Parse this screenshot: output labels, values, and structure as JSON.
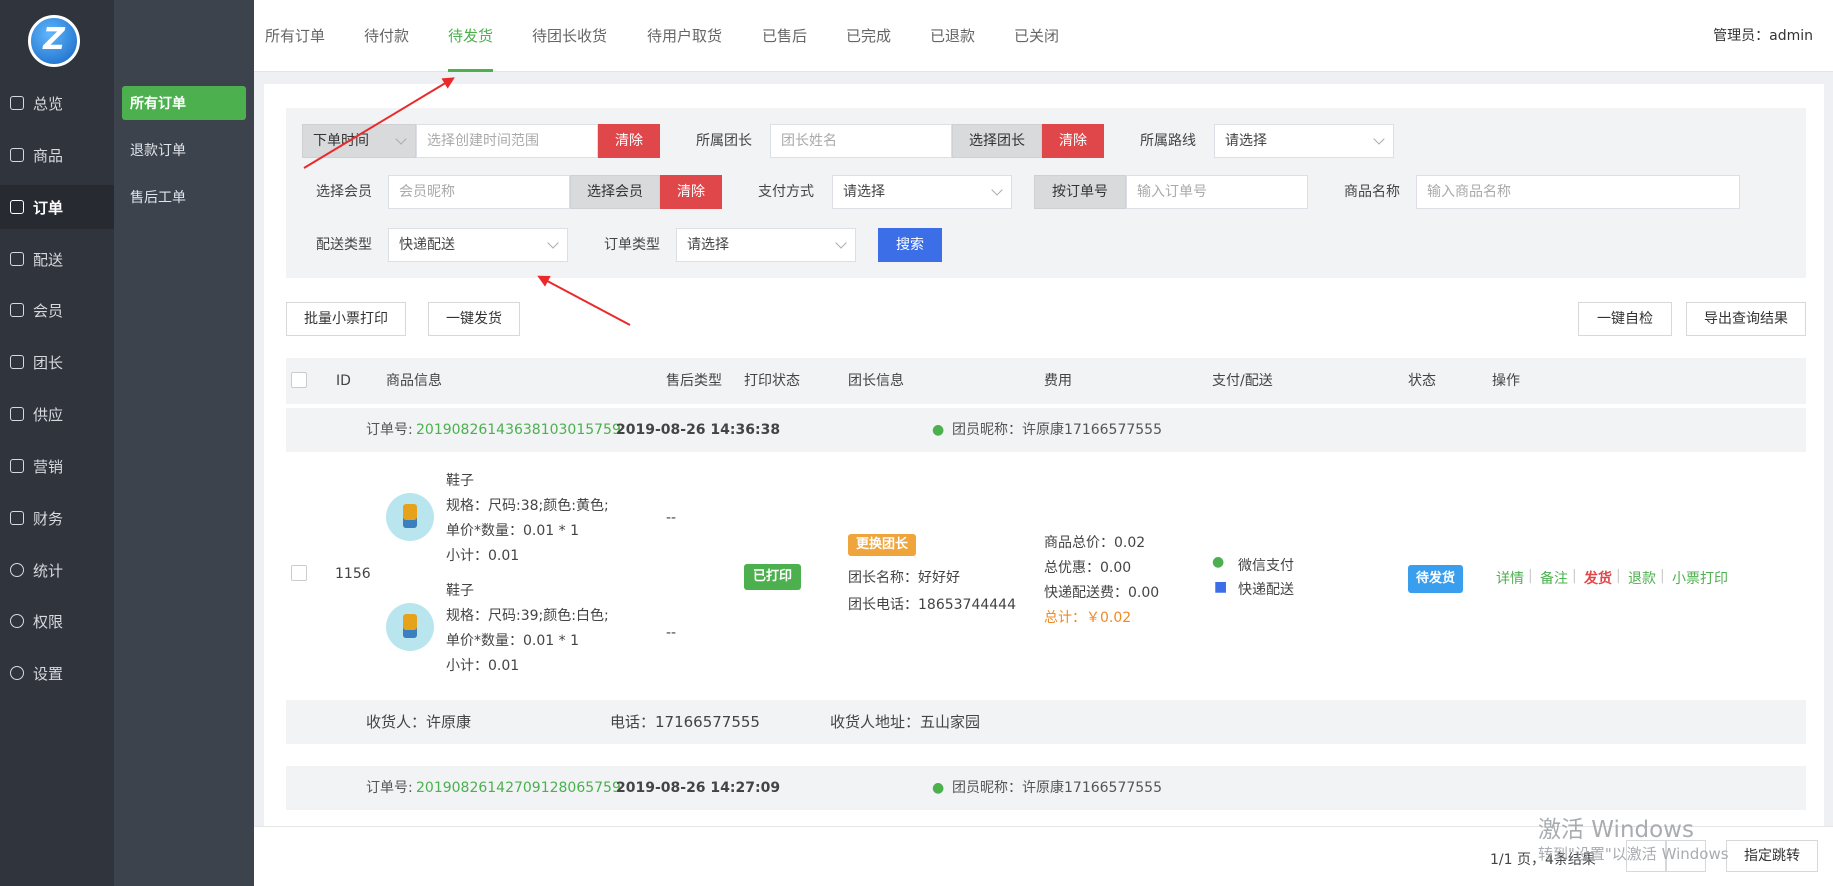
{
  "sidebar": {
    "logo": "Z",
    "items": [
      {
        "label": "总览"
      },
      {
        "label": "商品"
      },
      {
        "label": "订单"
      },
      {
        "label": "配送"
      },
      {
        "label": "会员"
      },
      {
        "label": "团长"
      },
      {
        "label": "供应"
      },
      {
        "label": "营销"
      },
      {
        "label": "财务"
      },
      {
        "label": "统计"
      },
      {
        "label": "权限"
      },
      {
        "label": "设置"
      }
    ],
    "active_index": 2
  },
  "subnav": {
    "items": [
      {
        "label": "所有订单"
      },
      {
        "label": "退款订单"
      },
      {
        "label": "售后工单"
      }
    ]
  },
  "tabs": [
    {
      "label": "所有订单"
    },
    {
      "label": "待付款"
    },
    {
      "label": "待发货"
    },
    {
      "label": "待团长收货"
    },
    {
      "label": "待用户取货"
    },
    {
      "label": "已售后"
    },
    {
      "label": "已完成"
    },
    {
      "label": "已退款"
    },
    {
      "label": "已关闭"
    }
  ],
  "admin": "管理员：admin",
  "filters": {
    "time_select": "下单时间",
    "time_placeholder": "选择创建时间范围",
    "clear": "清除",
    "leader_label": "所属团长",
    "leader_placeholder": "团长姓名",
    "choose_leader": "选择团长",
    "route_label": "所属路线",
    "route_value": "请选择",
    "member_label": "选择会员",
    "member_placeholder": "会员昵称",
    "choose_member": "选择会员",
    "pay_label": "支付方式",
    "pay_value": "请选择",
    "order_no_btn": "按订单号",
    "order_no_placeholder": "输入订单号",
    "goods_label": "商品名称",
    "goods_placeholder": "输入商品名称",
    "delivery_label": "配送类型",
    "delivery_value": "快递配送",
    "order_type_label": "订单类型",
    "order_type_value": "请选择",
    "search": "搜索"
  },
  "actions": {
    "batch_print": "批量小票打印",
    "one_ship": "一键发货",
    "self_check": "一键自检",
    "export": "导出查询结果"
  },
  "table": {
    "headers": [
      "ID",
      "商品信息",
      "售后类型",
      "打印状态",
      "团长信息",
      "费用",
      "支付/配送",
      "状态",
      "操作"
    ]
  },
  "orders": [
    {
      "no_label": "订单号:",
      "no": "201908261436381030157​59",
      "time": "2019-08-26 14:36:38",
      "member": "团员昵称：许原康17166577555",
      "id": "1156",
      "goods": [
        {
          "name": "鞋子",
          "spec": "规格：尺码:38;颜色:黄色;",
          "price": "单价*数量：0.01 * 1",
          "subtotal": "小计：0.01",
          "after_sale": "--"
        },
        {
          "name": "鞋子",
          "spec": "规格：尺码:39;颜色:白色;",
          "price": "单价*数量：0.01 * 1",
          "subtotal": "小计：0.01",
          "after_sale": "--"
        }
      ],
      "print_status": "已打印",
      "change_leader": "更换团长",
      "leader_name": "团长名称：好好好",
      "leader_phone": "团长电话：18653744444",
      "fee_total": "商品总价：0.02",
      "fee_discount": "总优惠：0.00",
      "fee_ship": "快递配送费：0.00",
      "fee_sum": "总计：￥0.02",
      "pay": "微信支付",
      "delivery": "快递配送",
      "status": "待发货",
      "ops": [
        "详情",
        "备注",
        "发货",
        "退款",
        "小票打印"
      ],
      "receiver": "收货人：许原康",
      "phone": "电话：17166577555",
      "address": "收货人地址：五山家园"
    },
    {
      "no_label": "订单号:",
      "no": "201908261427091280657​59",
      "time": "2019-08-26 14:27:09",
      "member": "团员昵称：许原康17166577555"
    }
  ],
  "pager": {
    "info": "1/1 页，4条结果",
    "jump": "指定跳转"
  },
  "watermark": {
    "line1": "激活 Windows",
    "line2": "转到\"设置\"以激活 Windows"
  },
  "colors": {
    "green": "#4cb04e",
    "red": "#e0474a",
    "blue": "#3c6ee8",
    "orange": "#f0a43c",
    "sidebar": "#30343c"
  }
}
